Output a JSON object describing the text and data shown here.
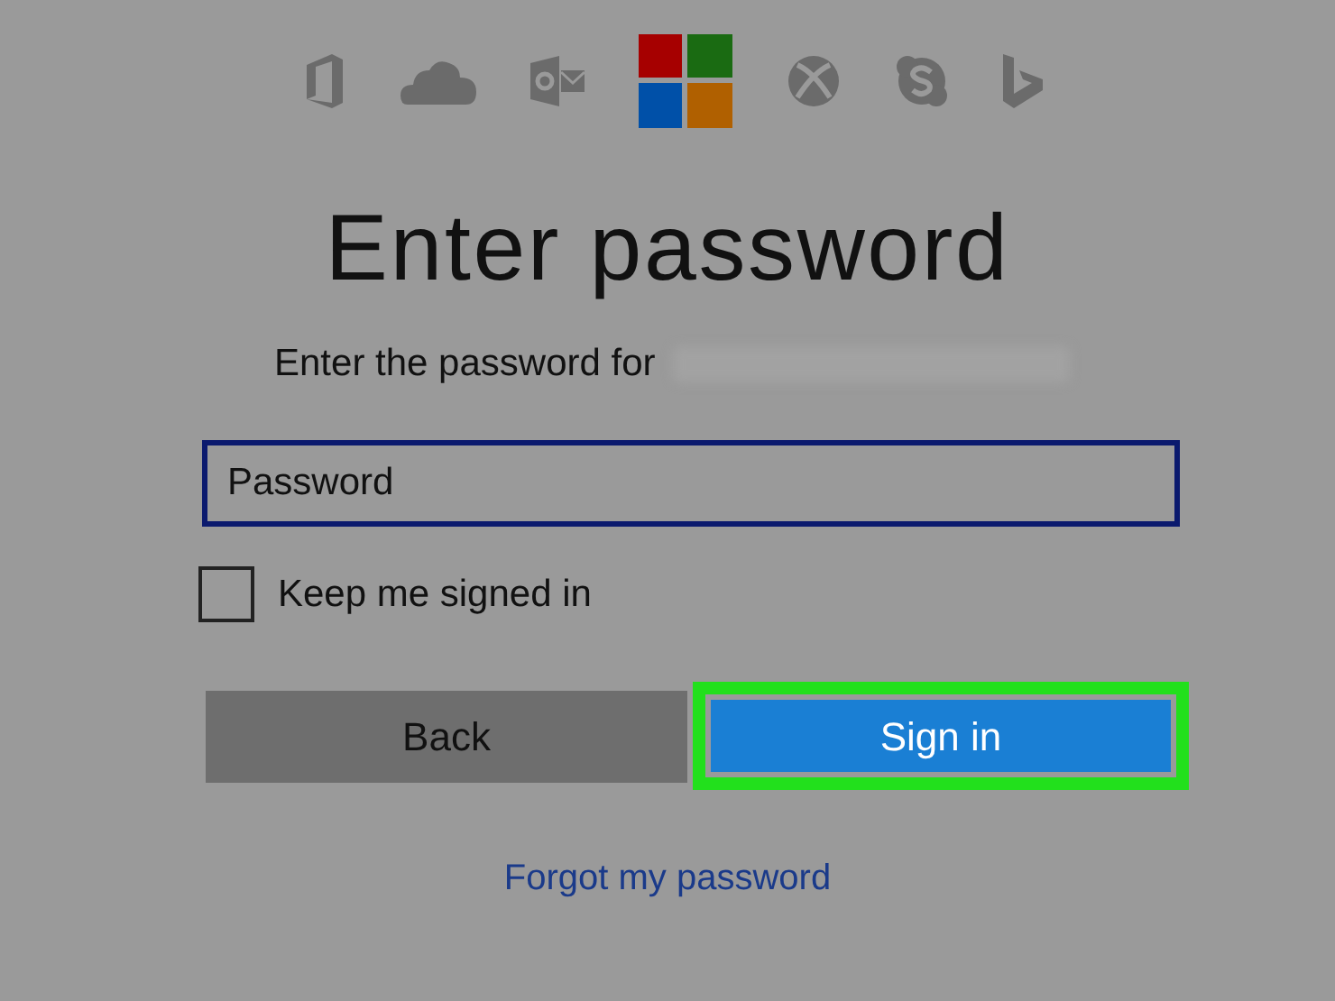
{
  "title": "Enter password",
  "prompt": "Enter the password for",
  "password_field": {
    "placeholder": "Password"
  },
  "keep_signed_in": {
    "label": "Keep me signed in",
    "checked": false
  },
  "buttons": [
    {
      "label": "Back",
      "kind": "secondary",
      "highlighted": false
    },
    {
      "label": "Sign in",
      "kind": "primary",
      "highlighted": true
    }
  ],
  "forgot_link": "Forgot my password"
}
